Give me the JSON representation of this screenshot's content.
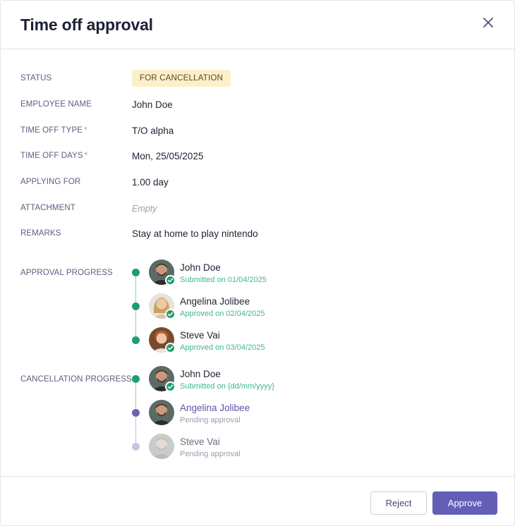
{
  "header": {
    "title": "Time off approval"
  },
  "fields": {
    "status": {
      "label": "STATUS",
      "value": "FOR CANCELLATION"
    },
    "employee_name": {
      "label": "EMPLOYEE NAME",
      "value": "John Doe"
    },
    "time_off_type": {
      "label": "TIME OFF TYPE",
      "required": "*",
      "value": "T/O alpha"
    },
    "time_off_days": {
      "label": "TIME OFF DAYS",
      "required": "*",
      "value": "Mon, 25/05/2025"
    },
    "applying_for": {
      "label": "APPLYING FOR",
      "value": "1.00 day"
    },
    "attachment": {
      "label": "ATTACHMENT",
      "value": "Empty"
    },
    "remarks": {
      "label": "REMARKS",
      "value": "Stay at home to play nintendo"
    }
  },
  "approval_progress": {
    "label": "APPROVAL PROGRESS",
    "steps": [
      {
        "name": "John Doe",
        "status": "Submitted on 01/04/2025",
        "state": "done"
      },
      {
        "name": "Angelina Jolibee",
        "status": "Approved on 02/04/2025",
        "state": "done"
      },
      {
        "name": "Steve Vai",
        "status": "Approved on 03/04/2025",
        "state": "done"
      }
    ]
  },
  "cancellation_progress": {
    "label": "CANCELLATION PROGRESS",
    "steps": [
      {
        "name": "John Doe",
        "status": "Submitted on {dd/mm/yyyy}",
        "state": "done"
      },
      {
        "name": "Angelina Jolibee",
        "status": "Pending approval",
        "state": "current"
      },
      {
        "name": "Steve Vai",
        "status": "Pending approval",
        "state": "upcoming"
      }
    ]
  },
  "actions": {
    "reject_label": "Reject",
    "approve_label": "Approve"
  },
  "colors": {
    "accent": "#645fb6",
    "success": "#1f9e6d",
    "badge_bg": "#fbf0c9"
  }
}
